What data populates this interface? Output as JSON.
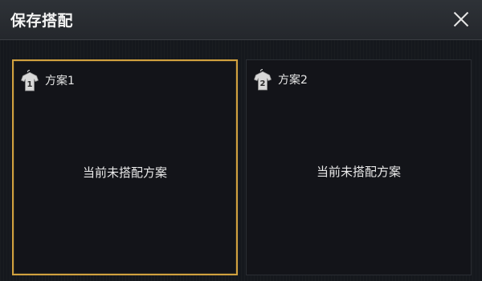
{
  "dialog": {
    "title": "保存搭配",
    "close_label": "X"
  },
  "plans": [
    {
      "name": "方案1",
      "number": "1",
      "empty_text": "当前未搭配方案",
      "selected": true
    },
    {
      "name": "方案2",
      "number": "2",
      "empty_text": "当前未搭配方案",
      "selected": false
    }
  ],
  "colors": {
    "selected_border": "#d1a13f",
    "header_bg": "#2a2d32",
    "panel_bg": "#131419"
  }
}
